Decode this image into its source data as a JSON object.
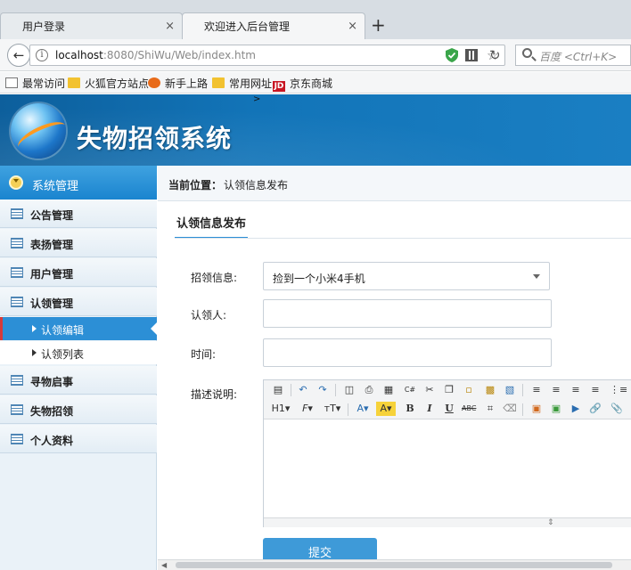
{
  "browser": {
    "tabs": [
      {
        "label": "用户登录",
        "close": "×"
      },
      {
        "label": "欢迎进入后台管理",
        "close": "×"
      }
    ],
    "new_tab": "+",
    "url_host": "localhost",
    "url_rest": ":8080/ShiWu/Web/index.htm",
    "search_placeholder": "百度 <Ctrl+K>",
    "bookmarks": [
      {
        "label": "最常访问",
        "icon": "bookmark-icon"
      },
      {
        "label": "火狐官方站点",
        "icon": "folder-icon"
      },
      {
        "label": "新手上路",
        "icon": "firefox-icon"
      },
      {
        "label": "常用网址",
        "icon": "folder-icon"
      },
      {
        "label": "京东商城",
        "icon": "jd-icon",
        "icon_text": "JD"
      }
    ]
  },
  "app": {
    "title": "失物招领系统",
    "header_mark": ">"
  },
  "sidebar": {
    "head_label": "系统管理",
    "items": [
      {
        "label": "公告管理"
      },
      {
        "label": "表扬管理"
      },
      {
        "label": "用户管理"
      },
      {
        "label": "认领管理"
      },
      {
        "label": "认领编辑",
        "sub": true,
        "active": true
      },
      {
        "label": "认领列表",
        "sub": true
      },
      {
        "label": "寻物启事"
      },
      {
        "label": "失物招领"
      },
      {
        "label": "个人资料"
      }
    ]
  },
  "main": {
    "crumb_label": "当前位置：",
    "crumb_value": "认领信息发布",
    "section_title": "认领信息发布",
    "form": {
      "zhaoling_label": "招领信息:",
      "zhaoling_value": "捡到一个小米4手机",
      "renlingren_label": "认领人:",
      "renlingren_value": "",
      "time_label": "时间:",
      "time_value": "",
      "desc_label": "描述说明:",
      "submit_label": "提交"
    },
    "editor_toolbar": {
      "row1": [
        "source",
        "undo",
        "redo",
        "preview",
        "print",
        "template",
        "code",
        "cut",
        "copy",
        "paste",
        "paste-text",
        "paste-word",
        "align-left",
        "align-center",
        "align-right",
        "justify",
        "ordered-list"
      ],
      "row2": [
        "H1▾",
        "𝓕▾",
        "тT▾",
        "A▾",
        "A▾",
        "B",
        "I",
        "U",
        "ABC",
        "⌗",
        "eraser",
        "image",
        "flash",
        "media",
        "link",
        "attach"
      ]
    }
  },
  "colors": {
    "header_blue": "#1274b8",
    "sidebar_active": "#2c8fd6",
    "submit": "#3e9ad8"
  }
}
